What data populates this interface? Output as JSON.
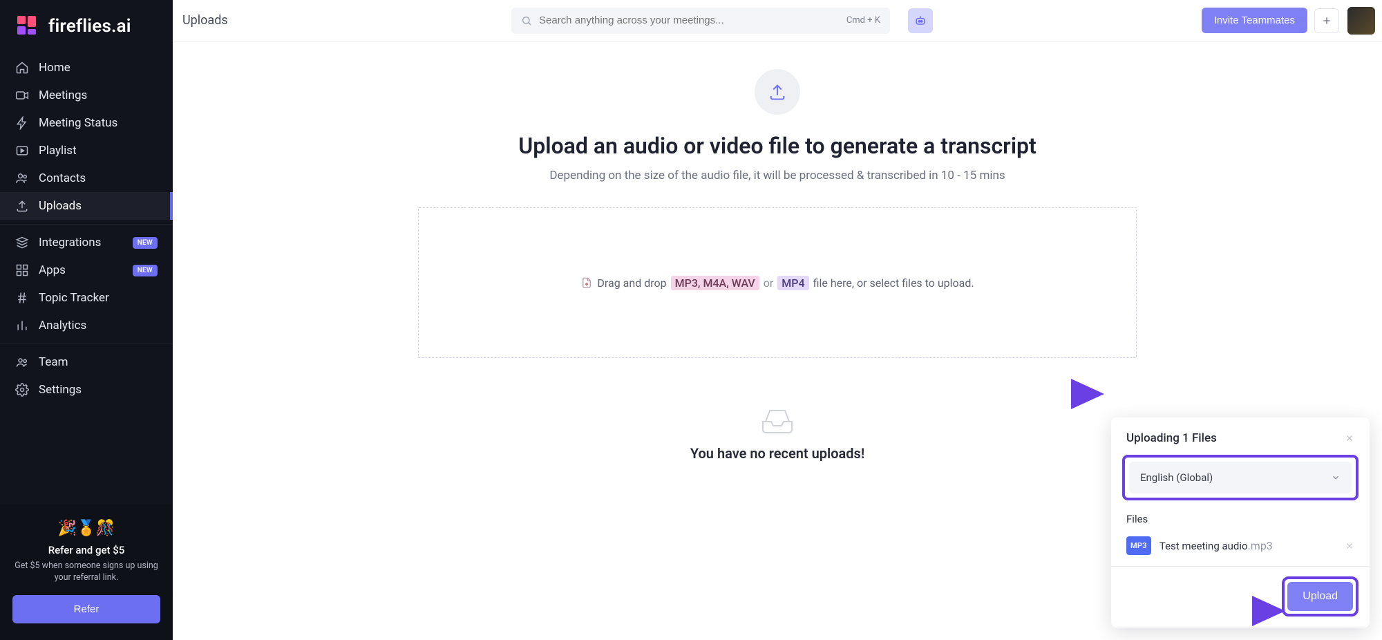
{
  "brand": "fireflies.ai",
  "header": {
    "page_title": "Uploads",
    "search_placeholder": "Search anything across your meetings...",
    "search_shortcut": "Cmd + K",
    "invite_label": "Invite Teammates"
  },
  "sidebar": {
    "items": [
      {
        "label": "Home"
      },
      {
        "label": "Meetings"
      },
      {
        "label": "Meeting Status"
      },
      {
        "label": "Playlist"
      },
      {
        "label": "Contacts"
      },
      {
        "label": "Uploads"
      }
    ],
    "items2": [
      {
        "label": "Integrations",
        "badge": "NEW"
      },
      {
        "label": "Apps",
        "badge": "NEW"
      },
      {
        "label": "Topic Tracker"
      },
      {
        "label": "Analytics"
      }
    ],
    "items3": [
      {
        "label": "Team"
      },
      {
        "label": "Settings"
      }
    ],
    "refer": {
      "title": "Refer and get $5",
      "subtitle": "Get $5 when someone signs up using your referral link.",
      "button": "Refer"
    }
  },
  "main": {
    "headline": "Upload an audio or video file to generate a transcript",
    "subline": "Depending on the size of the audio file, it will be processed & transcribed in 10 - 15 mins",
    "dropzone": {
      "lead": "Drag and drop",
      "audio_formats": "MP3, M4A, WAV",
      "or": "or",
      "video_formats": "MP4",
      "tail": "file here, or select files to upload."
    },
    "empty_text": "You have no recent uploads!"
  },
  "upload_panel": {
    "title": "Uploading 1 Files",
    "language": "English (Global)",
    "files_label": "Files",
    "file": {
      "badge": "MP3",
      "name": "Test meeting audio",
      "ext": ".mp3"
    },
    "button": "Upload"
  }
}
